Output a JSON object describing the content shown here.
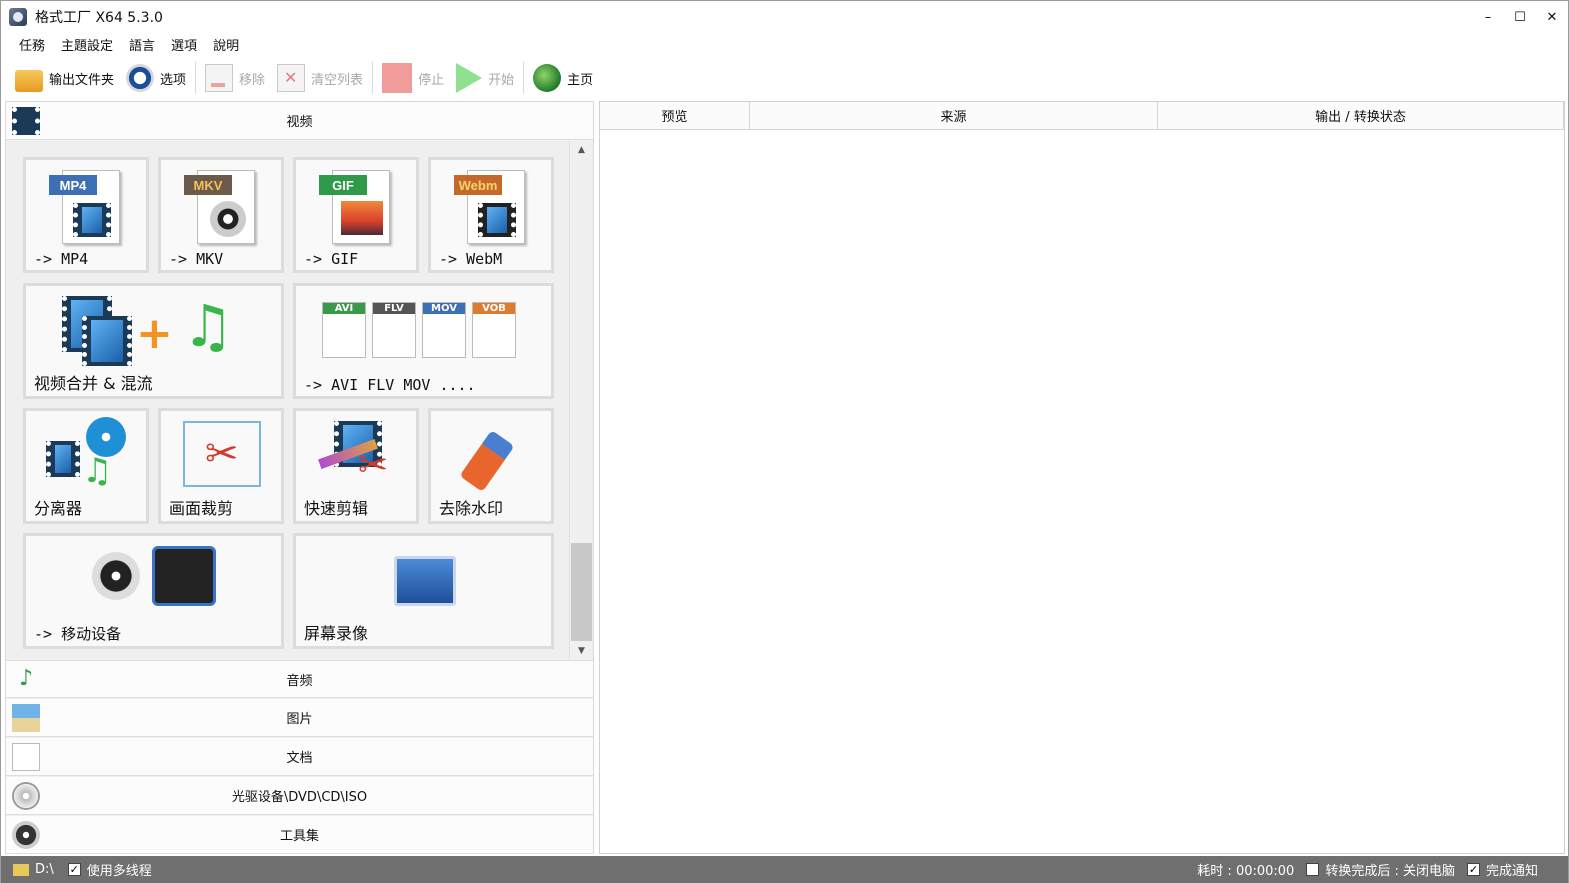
{
  "window": {
    "title": "格式工厂 X64 5.3.0",
    "minimize": "–",
    "maximize": "☐",
    "close": "✕"
  },
  "menu": [
    "任務",
    "主題設定",
    "語言",
    "選項",
    "說明"
  ],
  "toolbar": {
    "output_folder": "输出文件夹",
    "options": "选项",
    "remove": "移除",
    "clear_list": "清空列表",
    "stop": "停止",
    "start": "开始",
    "home": "主页"
  },
  "categories": {
    "video": "视频",
    "audio": "音频",
    "image": "图片",
    "document": "文档",
    "disc": "光驱设备\\DVD\\CD\\ISO",
    "tools": "工具集"
  },
  "tiles": {
    "mp4": {
      "label": "-> MP4",
      "tag": "MP4"
    },
    "mkv": {
      "label": "-> MKV",
      "tag": "MKV"
    },
    "gif": {
      "label": "-> GIF",
      "tag": "GIF"
    },
    "webm": {
      "label": "-> WebM",
      "tag": "Webm"
    },
    "merge": {
      "label": "视频合并 & 混流"
    },
    "multi": {
      "label": "-> AVI FLV MOV ....",
      "tags": [
        "AVI",
        "FLV",
        "MOV",
        "VOB"
      ]
    },
    "splitter": {
      "label": "分离器"
    },
    "crop": {
      "label": "画面裁剪"
    },
    "quick_edit": {
      "label": "快速剪辑"
    },
    "watermark": {
      "label": "去除水印"
    },
    "mobile": {
      "label": "-> 移动设备"
    },
    "screen_rec": {
      "label": "屏幕录像"
    }
  },
  "columns": [
    "预览",
    "来源",
    "输出 / 转换状态"
  ],
  "status": {
    "drive": "D:\\",
    "multithread": "使用多线程",
    "elapsed": "耗时 : 00:00:00",
    "after_convert": "转换完成后 : 关闭电脑",
    "notify": "完成通知"
  },
  "colors": {
    "mp4_tag": "#3d6fb5",
    "mkv_tag": "#6c5a4a",
    "gif_tag": "#2e9a4a",
    "webm_tag": "#c5682b",
    "status_bg": "#6f6f6f"
  }
}
